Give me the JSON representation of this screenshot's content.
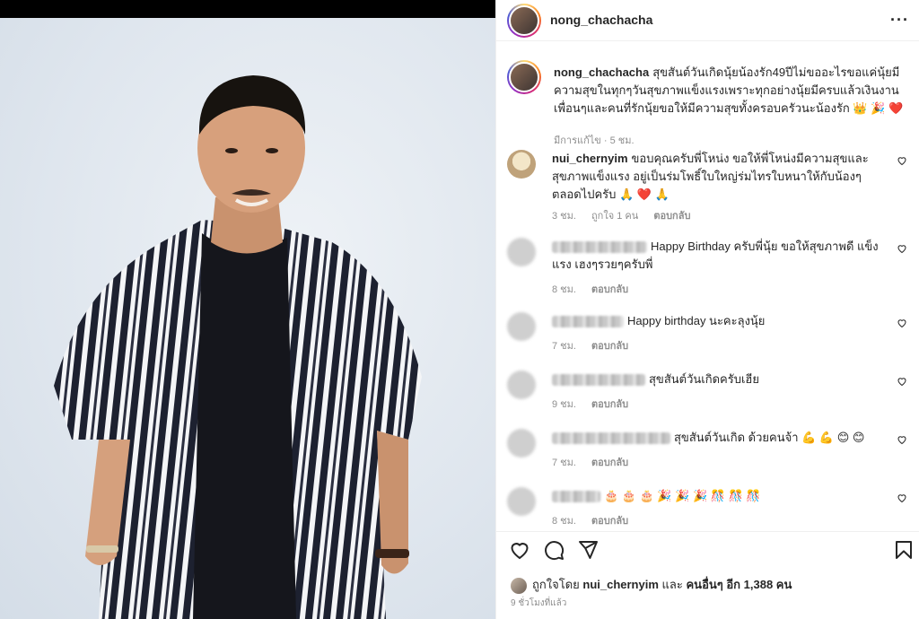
{
  "header": {
    "username": "nong_chachacha"
  },
  "caption": {
    "username": "nong_chachacha",
    "text": "สุขสันต์วันเกิดนุ้ยน้องรัก49ปีไม่ขออะไรขอแค่นุ้ยมีความสุขในทุกๆวันสุขภาพแข็งแรงเพราะทุกอย่างนุ้ยมีครบแล้วเงินงานเพื่อนๆและคนที่รักนุ้ยขอให้มีความสุขทั้งครอบครัวนะน้องรัก 👑 🎉 ❤️",
    "edited": "มีการแก้ไข",
    "time": "5 ชม."
  },
  "comments": [
    {
      "username": "nui_chernyim",
      "text": "ขอบคุณครับพี่โหน่ง ขอให้พี่โหน่งมีความสุขและสุขภาพแข็งแรง อยู่เป็นร่มโพธิ์ใบใหญ่ร่มไทรใบหนาให้กับน้องๆ ตลอดไปครับ 🙏 ❤️ 🙏",
      "time": "3 ชม.",
      "likes": "ถูกใจ 1 คน",
      "reply": "ตอบกลับ"
    },
    {
      "username": "",
      "text": "Happy Birthday ครับพี่นุ้ย ขอให้สุขภาพดี แข็งแรง เฮงๆรวยๆครับพี่",
      "time": "8 ชม.",
      "reply": "ตอบกลับ"
    },
    {
      "username": "",
      "text": "Happy birthday นะคะลุงนุ้ย",
      "time": "7 ชม.",
      "reply": "ตอบกลับ"
    },
    {
      "username": "",
      "text": "สุขสันต์วันเกิดครับเฮีย",
      "time": "9 ชม.",
      "reply": "ตอบกลับ"
    },
    {
      "username": "",
      "text": "สุขสันต์วันเกิด ด้วยคนจ้า 💪 💪 😊 😊",
      "time": "7 ชม.",
      "reply": "ตอบกลับ"
    },
    {
      "username": "",
      "text": "🎂 🎂 🎂 🎉 🎉 🎉 🎊 🎊 🎊",
      "time": "8 ชม.",
      "reply": "ตอบกลับ"
    }
  ],
  "likes": {
    "prefix": "ถูกใจโดย",
    "user": "nui_chernyim",
    "middle": "และ",
    "others": "คนอื่นๆ อีก 1,388 คน"
  },
  "ago": "9 ชั่วโมงที่แล้ว",
  "icons": {
    "more": "more-options-icon",
    "heart": "heart-icon",
    "comment": "comment-icon",
    "share": "share-icon",
    "save": "bookmark-icon"
  }
}
